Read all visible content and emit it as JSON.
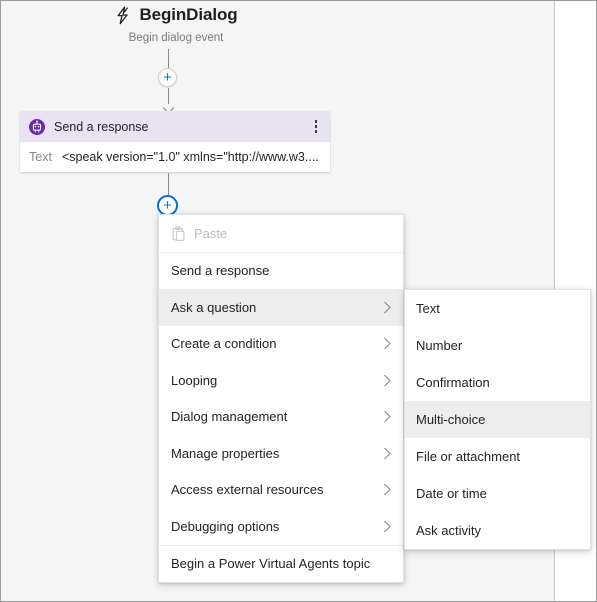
{
  "trigger": {
    "icon": "lightning-bolt-icon",
    "title": "BeginDialog",
    "subtitle": "Begin dialog event"
  },
  "node": {
    "icon": "send-response-bot-icon",
    "title": "Send a response",
    "kebab": "more-options-icon",
    "field_label": "Text",
    "field_value": "<speak version=\"1.0\" xmlns=\"http://www.w3...."
  },
  "add_buttons": {
    "top_label": "+",
    "bottom_label": "+"
  },
  "menu": {
    "items": [
      {
        "label": "Paste",
        "icon": "clipboard-paste-icon",
        "disabled": true,
        "submenu": false,
        "highlight": false,
        "separator_after": true
      },
      {
        "label": "Send a response",
        "disabled": false,
        "submenu": false,
        "highlight": false,
        "separator_after": false
      },
      {
        "label": "Ask a question",
        "disabled": false,
        "submenu": true,
        "highlight": true,
        "separator_after": false
      },
      {
        "label": "Create a condition",
        "disabled": false,
        "submenu": true,
        "highlight": false,
        "separator_after": false
      },
      {
        "label": "Looping",
        "disabled": false,
        "submenu": true,
        "highlight": false,
        "separator_after": false
      },
      {
        "label": "Dialog management",
        "disabled": false,
        "submenu": true,
        "highlight": false,
        "separator_after": false
      },
      {
        "label": "Manage properties",
        "disabled": false,
        "submenu": true,
        "highlight": false,
        "separator_after": false
      },
      {
        "label": "Access external resources",
        "disabled": false,
        "submenu": true,
        "highlight": false,
        "separator_after": false
      },
      {
        "label": "Debugging options",
        "disabled": false,
        "submenu": true,
        "highlight": false,
        "separator_after": true
      },
      {
        "label": "Begin a Power Virtual Agents topic",
        "disabled": false,
        "submenu": false,
        "highlight": false,
        "separator_after": false
      }
    ]
  },
  "submenu": {
    "parent": "Ask a question",
    "items": [
      {
        "label": "Text",
        "highlight": false
      },
      {
        "label": "Number",
        "highlight": false
      },
      {
        "label": "Confirmation",
        "highlight": false
      },
      {
        "label": "Multi-choice",
        "highlight": true
      },
      {
        "label": "File or attachment",
        "highlight": false
      },
      {
        "label": "Date or time",
        "highlight": false
      },
      {
        "label": "Ask activity",
        "highlight": false
      }
    ]
  },
  "colors": {
    "canvas": "#f5f5f5",
    "node_header": "#e9e2f3",
    "node_icon": "#6b2ba0",
    "accent_blue": "#0f6cbd",
    "menu_highlight": "#ededed"
  }
}
